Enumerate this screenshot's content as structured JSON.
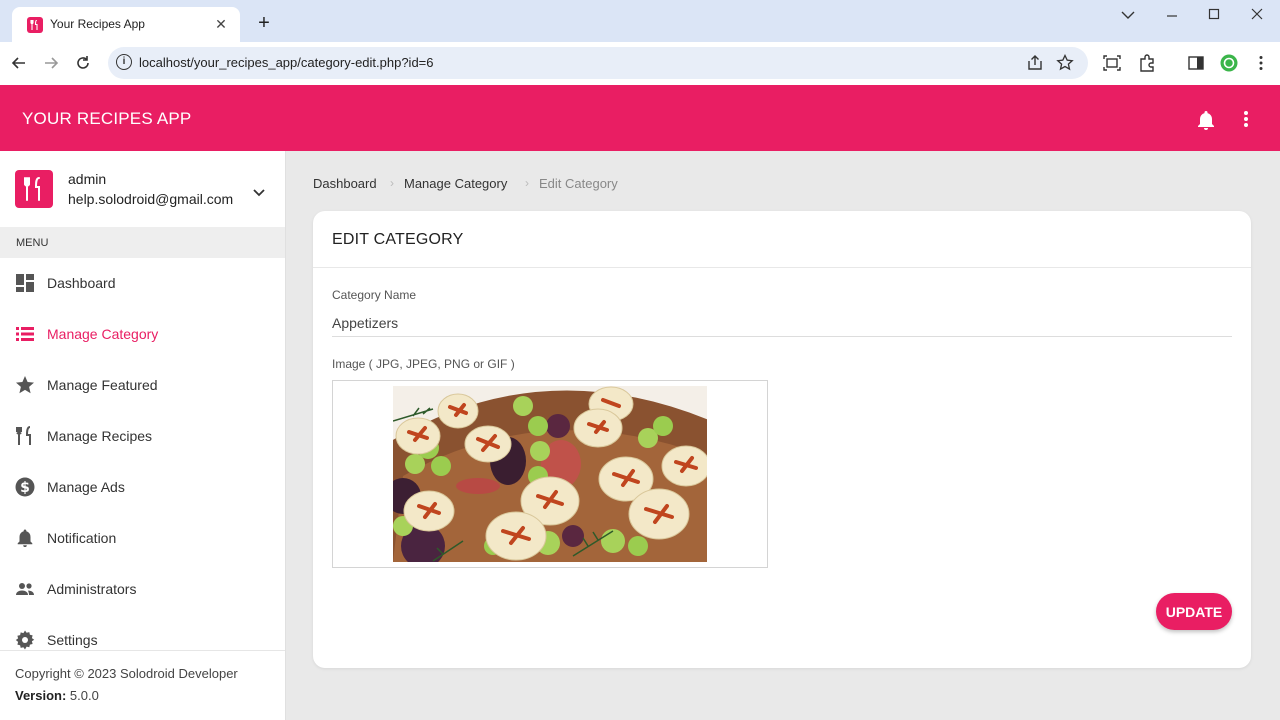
{
  "browser": {
    "tab_title": "Your Recipes App",
    "url": "localhost/your_recipes_app/category-edit.php?id=6"
  },
  "app": {
    "title": "YOUR RECIPES APP",
    "accent": "#e91e63"
  },
  "user": {
    "name": "admin",
    "email": "help.solodroid@gmail.com"
  },
  "sidebar": {
    "menu_header": "MENU",
    "items": [
      {
        "label": "Dashboard",
        "icon": "dashboard-icon",
        "active": false
      },
      {
        "label": "Manage Category",
        "icon": "list-icon",
        "active": true
      },
      {
        "label": "Manage Featured",
        "icon": "star-icon",
        "active": false
      },
      {
        "label": "Manage Recipes",
        "icon": "fork-knife-icon",
        "active": false
      },
      {
        "label": "Manage Ads",
        "icon": "dollar-icon",
        "active": false
      },
      {
        "label": "Notification",
        "icon": "bell-icon",
        "active": false
      },
      {
        "label": "Administrators",
        "icon": "people-icon",
        "active": false
      },
      {
        "label": "Settings",
        "icon": "gear-icon",
        "active": false
      }
    ],
    "footer": {
      "copyright": "Copyright © 2023 Solodroid Developer",
      "version_label": "Version:",
      "version_value": "5.0.0"
    }
  },
  "breadcrumb": [
    "Dashboard",
    "Manage Category",
    "Edit Category"
  ],
  "form": {
    "title": "EDIT CATEGORY",
    "name_label": "Category Name",
    "name_value": "Appetizers",
    "image_label": "Image ( JPG, JPEG, PNG or GIF )",
    "update_label": "UPDATE"
  }
}
